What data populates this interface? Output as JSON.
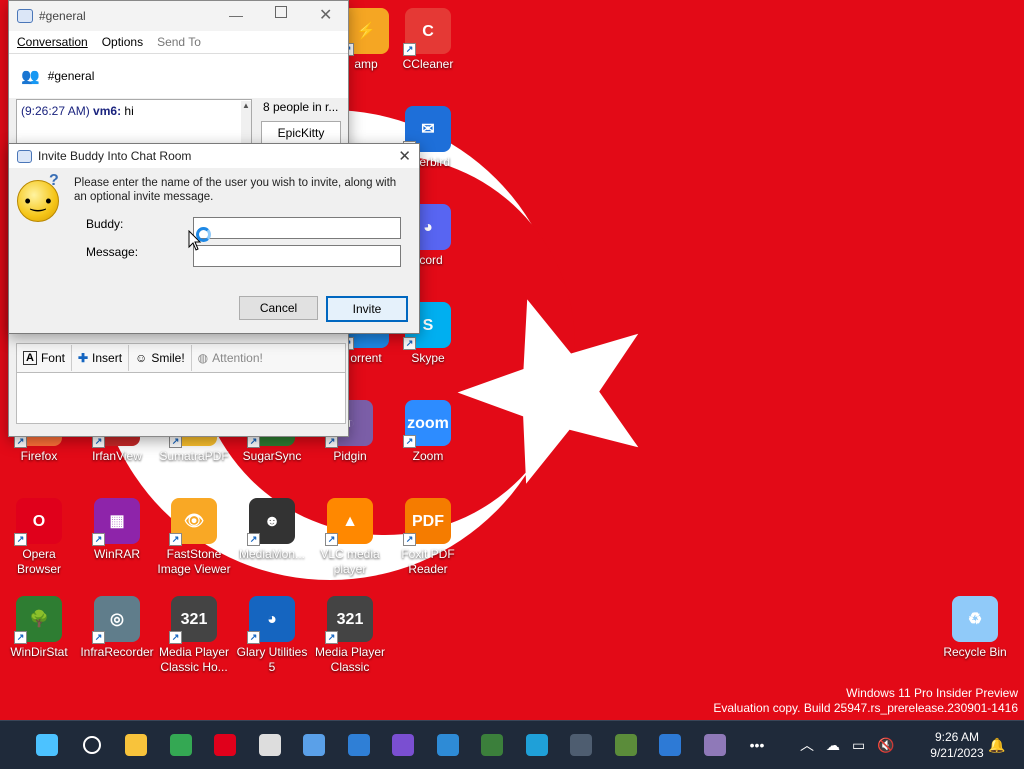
{
  "desktop": {
    "icons": [
      {
        "label": "amp",
        "color": "#f5a623",
        "glyph": "⚡"
      },
      {
        "label": "CCleaner",
        "color": "#e53935",
        "glyph": "C"
      },
      {
        "label": "nderbird",
        "color": "#1e6fd9",
        "glyph": "✉"
      },
      {
        "label": "scord",
        "color": "#5865f2",
        "glyph": "◕"
      },
      {
        "label": "orrent",
        "color": "#1e88e5",
        "glyph": "μ"
      },
      {
        "label": "Skype",
        "color": "#00aff0",
        "glyph": "S"
      },
      {
        "label": "Firefox",
        "color": "#ff7139",
        "glyph": "🦊"
      },
      {
        "label": "IrfanView",
        "color": "#c62828",
        "glyph": "✿"
      },
      {
        "label": "SumatraPDF",
        "color": "#fbc02d",
        "glyph": "S"
      },
      {
        "label": "SugarSync",
        "color": "#2e7d32",
        "glyph": "◒"
      },
      {
        "label": "Pidgin",
        "color": "#7b5ea7",
        "glyph": "◐"
      },
      {
        "label": "Zoom",
        "color": "#2d8cff",
        "glyph": "zoom"
      },
      {
        "label": "Opera Browser",
        "color": "#e0001b",
        "glyph": "O"
      },
      {
        "label": "WinRAR",
        "color": "#8e24aa",
        "glyph": "▦"
      },
      {
        "label": "FastStone Image Viewer",
        "color": "#f9a825",
        "glyph": "👁"
      },
      {
        "label": "MediaMon...",
        "color": "#333333",
        "glyph": "☻"
      },
      {
        "label": "VLC media player",
        "color": "#ff8800",
        "glyph": "▲"
      },
      {
        "label": "Foxit PDF Reader",
        "color": "#f57c00",
        "glyph": "PDF"
      },
      {
        "label": "WinDirStat",
        "color": "#2e7d32",
        "glyph": "🌳"
      },
      {
        "label": "InfraRecorder",
        "color": "#607d8b",
        "glyph": "◎"
      },
      {
        "label": "Media Player Classic Ho...",
        "color": "#444444",
        "glyph": "321"
      },
      {
        "label": "Glary Utilities 5",
        "color": "#1565c0",
        "glyph": "◕"
      },
      {
        "label": "Media Player Classic",
        "color": "#444444",
        "glyph": "321"
      },
      {
        "label": "Recycle Bin",
        "color": "#90caf9",
        "glyph": "♻"
      }
    ],
    "watermark_line1": "Windows 11 Pro Insider Preview",
    "watermark_line2": "Evaluation copy. Build 25947.rs_prerelease.230901-1416"
  },
  "chat_window": {
    "title": "#general",
    "menu": [
      "Conversation",
      "Options",
      "Send To"
    ],
    "room_name": "#general",
    "message_time": "(9:26:27 AM)",
    "message_user": "vm6:",
    "message_text": "hi",
    "people_count": "8 people in r...",
    "user_first": "EpicKitty",
    "toolbar": {
      "font": "Font",
      "insert": "Insert",
      "smile": "Smile!",
      "attention": "Attention!"
    }
  },
  "invite_dialog": {
    "title": "Invite Buddy Into Chat Room",
    "prompt": "Please enter the name of the user you wish to invite, along with an optional invite message.",
    "buddy_label": "Buddy:",
    "message_label": "Message:",
    "buddy_value": "",
    "message_value": "",
    "cancel_label": "Cancel",
    "invite_label": "Invite"
  },
  "taskbar": {
    "time": "9:26 AM",
    "date": "9/21/2023",
    "more": "•••"
  },
  "colors": {
    "flag_red": "#e30a17",
    "accent": "#0067c0",
    "taskbar": "#1f2a3a"
  }
}
